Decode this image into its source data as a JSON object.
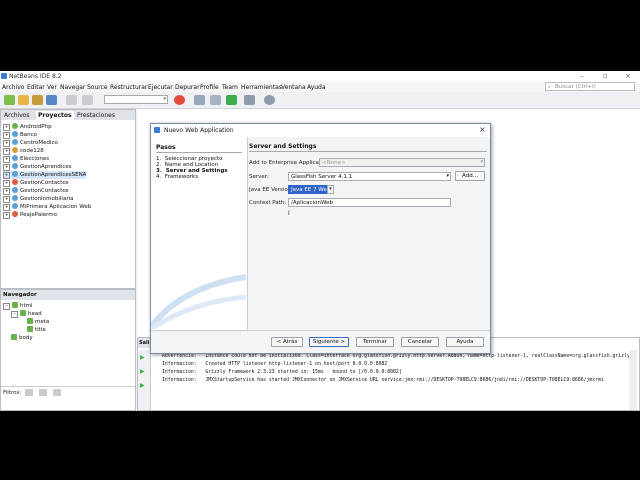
{
  "window": {
    "title": "NetBeans IDE 8.2"
  },
  "menubar": [
    "Archivo",
    "Editar",
    "Ver",
    "Navegar",
    "Source",
    "Restructurar",
    "Ejecutar",
    "Depurar",
    "Profile",
    "Team",
    "Herramientas",
    "Ventana",
    "Ayuda"
  ],
  "search": {
    "placeholder": "Buscar (Ctrl+I)"
  },
  "projects_panel": {
    "tabs": [
      "Archivos",
      "Proyectos",
      "Prestaciones"
    ],
    "items": [
      "AndroidPhp",
      "Banco",
      "CentroMedico",
      "code128",
      "Elecciones",
      "GestionAprendices",
      "GestionAprendicesSENA",
      "GestionContactos",
      "GestionContactos",
      "GestionInmobiliaria",
      "MiPrimera Aplicacion Web",
      "PeajePalermo"
    ]
  },
  "navigator_panel": {
    "title": "Navegador",
    "nodes": [
      "html",
      "head",
      "meta",
      "title",
      "body"
    ],
    "filter_label": "Filtros:"
  },
  "output_panel": {
    "tab": "Sali",
    "lines": [
      "Advertencia:   Instance could not be initialized. Class=interface org.glassfish.grizly.http.server.AddOn, name=http-listener-1, realClassName=org.glassfish.grizly.h",
      "Informacion:   Created HTTP listener http-listener-1 on host/port 0.0.0.0:8082",
      "Informacion:   Grizzly Framework 2.3.23 started in: 15ms - bound to [/0.0.0.0:8082]",
      "Informacion:   JMXStartupService has started JMXConnector on JMXService URL service:jmx:rmi://DESKTOP-T08ELC9:8686/jndi/rmi://DESKTOP-T08ELC9:8686/jmxrmi"
    ]
  },
  "dialog": {
    "title": "Nuevo Web Application",
    "steps_heading": "Pasos",
    "steps": [
      {
        "num": "1.",
        "label": "Seleccionar proyecto"
      },
      {
        "num": "2.",
        "label": "Name and Location"
      },
      {
        "num": "3.",
        "label": "Server and Settings"
      },
      {
        "num": "4.",
        "label": "Frameworks"
      }
    ],
    "section_heading": "Server and Settings",
    "enterprise_label": "Add to Enterprise Application:",
    "enterprise_value": "<None>",
    "server_label": "Server:",
    "server_value": "GlassFish Server 4.1.1",
    "add_button": "Add...",
    "javaee_label": "Java EE Version:",
    "javaee_value": "Java EE 7 Web",
    "context_label": "Context Path:",
    "context_value": "/AplicacionWeb",
    "buttons": {
      "back": "< Atrás",
      "next": "Siguiente >",
      "finish": "Terminar",
      "cancel": "Cancelar",
      "help": "Ayuda"
    }
  },
  "colors": {
    "selection": "#2f65ca",
    "accent": "#3a6fc4"
  }
}
